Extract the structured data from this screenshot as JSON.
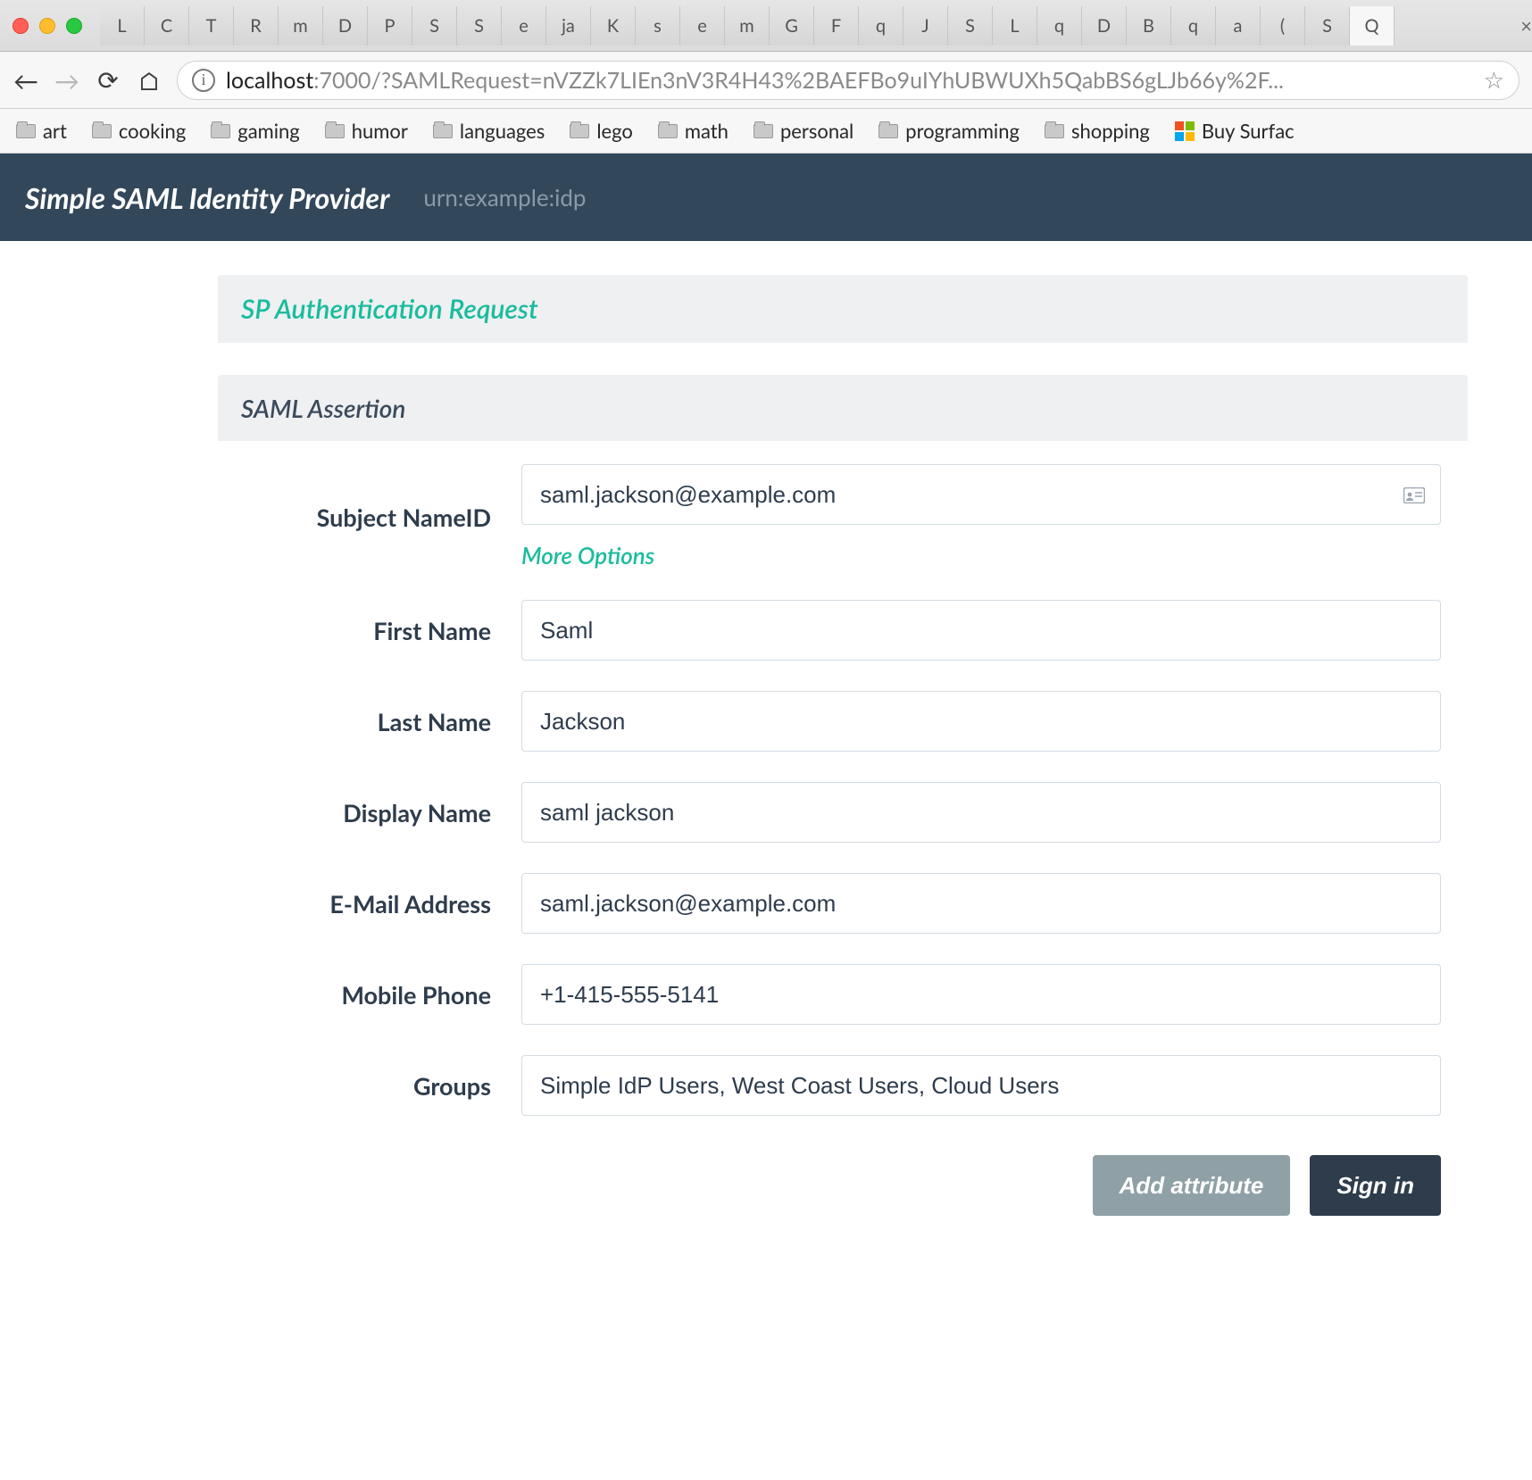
{
  "browser": {
    "tabs": [
      "L",
      "C",
      "T",
      "R",
      "m",
      "D",
      "P",
      "S",
      "S",
      "e",
      "ja",
      "K",
      "s",
      "e",
      "m",
      "G",
      "F",
      "q",
      "J",
      "S",
      "L",
      "q",
      "D",
      "B",
      "q",
      "a",
      "(",
      "S",
      "Q"
    ],
    "url_host": "localhost",
    "url_port": ":7000",
    "url_path": "/?SAMLRequest=nVZZk7LIEn3nV3R4H43%2BAEFBo9uIYhUBWUXh5QabBS6gLJb66y%2F...",
    "bookmarks": [
      "art",
      "cooking",
      "gaming",
      "humor",
      "languages",
      "lego",
      "math",
      "personal",
      "programming",
      "shopping"
    ],
    "buy_surface": "Buy Surfac"
  },
  "header": {
    "title": "Simple SAML Identity Provider",
    "subtitle": "urn:example:idp"
  },
  "panels": {
    "sp_request_title": "SP Authentication Request",
    "assertion_title": "SAML Assertion"
  },
  "form": {
    "subject_label": "Subject NameID",
    "subject_value": "saml.jackson@example.com",
    "more_options": "More Options",
    "first_name_label": "First Name",
    "first_name_value": "Saml",
    "last_name_label": "Last Name",
    "last_name_value": "Jackson",
    "display_name_label": "Display Name",
    "display_name_value": "saml jackson",
    "email_label": "E-Mail Address",
    "email_value": "saml.jackson@example.com",
    "mobile_label": "Mobile Phone",
    "mobile_value": "+1-415-555-5141",
    "groups_label": "Groups",
    "groups_value": "Simple IdP Users, West Coast Users, Cloud Users"
  },
  "actions": {
    "add_attribute": "Add attribute",
    "sign_in": "Sign in"
  }
}
